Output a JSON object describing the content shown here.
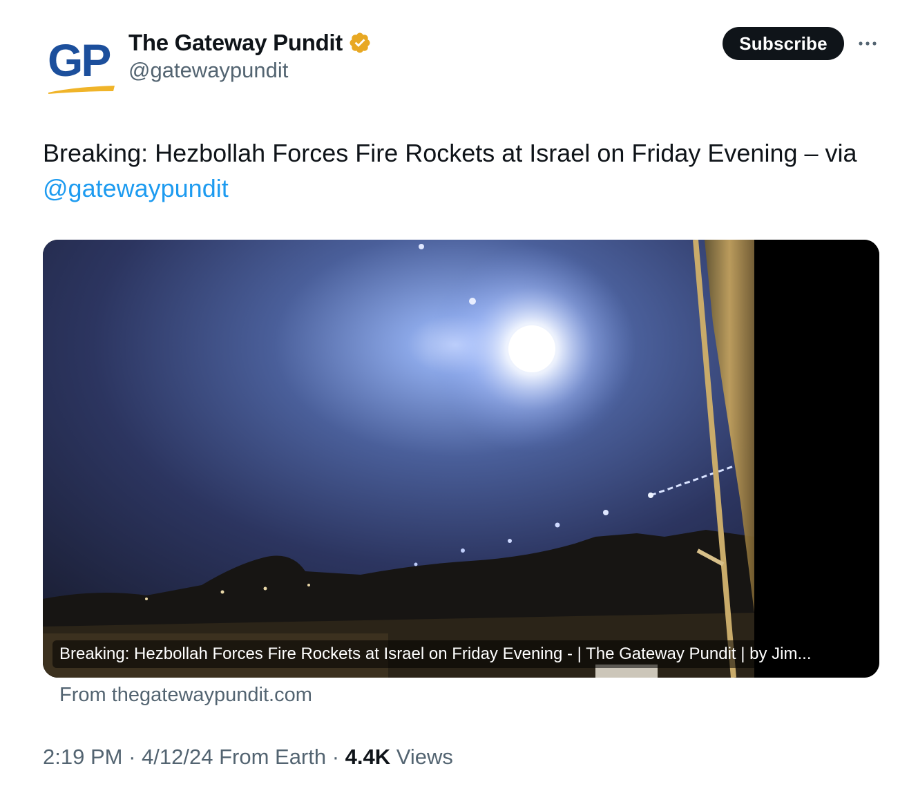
{
  "author": {
    "display_name": "The Gateway Pundit",
    "handle": "@gatewaypundit",
    "avatar_text": "GP",
    "verified_icon": "verified-gold-badge"
  },
  "actions": {
    "subscribe_label": "Subscribe",
    "more_icon": "more-horizontal-icon"
  },
  "tweet": {
    "text": "Breaking: Hezbollah Forces Fire Rockets at Israel on Friday Evening – via",
    "mention": "@gatewaypundit"
  },
  "card": {
    "caption": "Breaking: Hezbollah Forces Fire Rockets at Israel on Friday Evening - | The Gateway Pundit | by Jim...",
    "source": "From thegatewaypundit.com"
  },
  "meta": {
    "time": "2:19 PM",
    "separator": " · ",
    "date": "4/12/24",
    "origin": "From Earth",
    "views_count": "4.4K",
    "views_label": "Views"
  },
  "colors": {
    "link": "#1d9bf0",
    "secondary_text": "#536471",
    "primary_text": "#0f1419",
    "badge_gold": "#e8a823",
    "avatar_blue": "#1c4f9c",
    "avatar_underline": "#f0b429"
  }
}
